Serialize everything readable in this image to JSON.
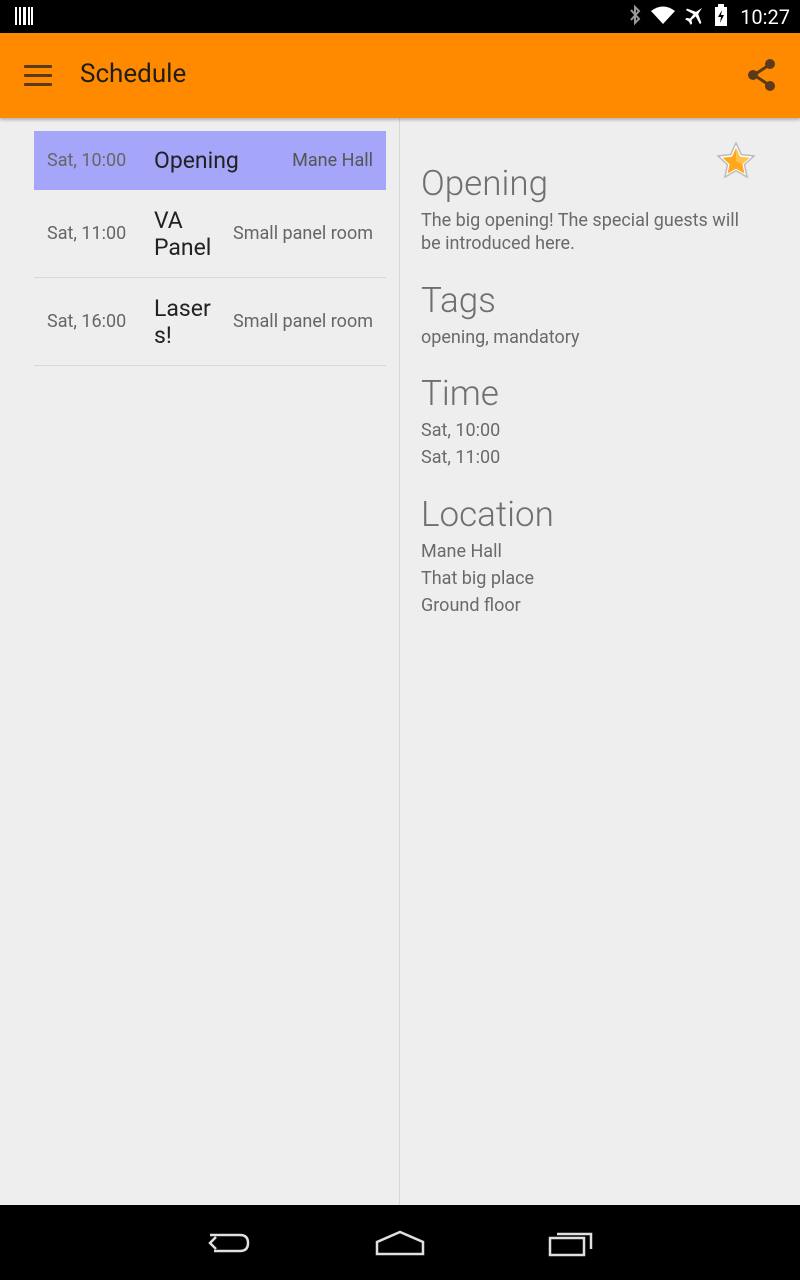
{
  "status": {
    "time": "10:27"
  },
  "appbar": {
    "title": "Schedule",
    "accent": "#FF8A00"
  },
  "schedule": [
    {
      "time": "Sat, 10:00",
      "name": "Opening",
      "location": "Mane Hall"
    },
    {
      "time": "Sat, 11:00",
      "name": "VA Panel",
      "location": "Small panel room"
    },
    {
      "time": "Sat, 16:00",
      "name": "Lasers!",
      "location": "Small panel room"
    }
  ],
  "detail": {
    "title": "Opening",
    "description": "The big opening! The special guests will be introduced here.",
    "tags_heading": "Tags",
    "tags": "opening, mandatory",
    "time_heading": "Time",
    "time_start": "Sat, 10:00",
    "time_end": "Sat, 11:00",
    "location_heading": "Location",
    "location_name": "Mane Hall",
    "location_desc": "That big place",
    "location_floor": "Ground floor"
  },
  "icons": {
    "menu": "menu-icon",
    "share": "share-icon",
    "star": "star-icon",
    "back": "back-icon",
    "home": "home-icon",
    "recents": "recents-icon"
  },
  "colors": {
    "selected_row": "#A5A5FA",
    "background": "#EEEEEE"
  }
}
